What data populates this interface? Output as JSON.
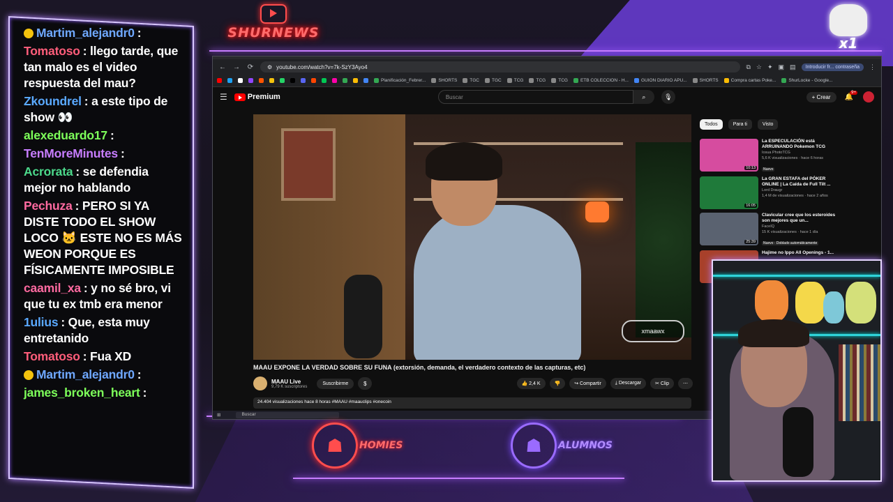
{
  "chat": {
    "messages": [
      {
        "user": "Martim_alejandr0",
        "text": ":",
        "color": "#6fa8ff",
        "badge": "#f4c20d"
      },
      {
        "user": "Tomatoso",
        "text": ": llego tarde, que tan malo es el video respuesta del mau?",
        "color": "#ff5d7a"
      },
      {
        "user": "Zkoundrel",
        "text": ": a este tipo de show 👀",
        "color": "#5aa9ff"
      },
      {
        "user": "alexeduardo17",
        "text": ":",
        "color": "#7dff5a"
      },
      {
        "user": "TenMoreMinutes",
        "text": ":",
        "color": "#c77dff"
      },
      {
        "user": "Acrorata",
        "text": ": se defendia mejor no hablando",
        "color": "#4cd98b"
      },
      {
        "user": "Pechuza",
        "text": ": PERO SI YA DISTE TODO EL SHOW LOCO 🐱 ESTE NO ES MÁS WEON PORQUE ES FÍSICAMENTE IMPOSIBLE",
        "color": "#ff6aa0"
      },
      {
        "user": "caamil_xa",
        "text": ": y no sé bro, vi que tu ex tmb era menor",
        "color": "#ff6aa0"
      },
      {
        "user": "1ulius",
        "text": ": Que, esta muy entretanido",
        "color": "#5aa9ff"
      },
      {
        "user": "Tomatoso",
        "text": ": Fua XD",
        "color": "#ff5d7a"
      },
      {
        "user": "Martim_alejandr0",
        "text": ":",
        "color": "#6fa8ff",
        "badge": "#f4c20d"
      },
      {
        "user": "james_broken_heart",
        "text": ":",
        "color": "#7dff5a"
      }
    ]
  },
  "logo": {
    "text": "SHURNEWS"
  },
  "x1": {
    "text": "x1"
  },
  "browser": {
    "url": "youtube.com/watch?v=7k-SzY3Ayo4",
    "profile_pill": "Introducir fr... contraseña",
    "bookmarks": [
      {
        "label": "",
        "color": "#ff0000"
      },
      {
        "label": "",
        "color": "#1da1f2"
      },
      {
        "label": "",
        "color": "#fff"
      },
      {
        "label": "",
        "color": "#9146ff"
      },
      {
        "label": "",
        "color": "#ff5500"
      },
      {
        "label": "",
        "color": "#f4c20d"
      },
      {
        "label": "",
        "color": "#25d366"
      },
      {
        "label": "",
        "color": "#000"
      },
      {
        "label": "",
        "color": "#5865f2"
      },
      {
        "label": "",
        "color": "#ff4500"
      },
      {
        "label": "",
        "color": "#00c853"
      },
      {
        "label": "",
        "color": "#ff00aa"
      },
      {
        "label": "",
        "color": "#34a853"
      },
      {
        "label": "",
        "color": "#fbbc04"
      },
      {
        "label": "",
        "color": "#4285f4"
      },
      {
        "label": "Planificación_Febrer...",
        "color": "#34a853"
      },
      {
        "label": "SHORTS",
        "color": "#888"
      },
      {
        "label": "TGC",
        "color": "#888"
      },
      {
        "label": "TGC",
        "color": "#888"
      },
      {
        "label": "TCG",
        "color": "#888"
      },
      {
        "label": "TCG",
        "color": "#888"
      },
      {
        "label": "TCG",
        "color": "#888"
      },
      {
        "label": "ETB COLECCION - H...",
        "color": "#34a853"
      },
      {
        "label": "GUION DIARIO APU...",
        "color": "#4285f4"
      },
      {
        "label": "SHORTS",
        "color": "#888"
      },
      {
        "label": "Compra cartas Poke...",
        "color": "#fbbc04"
      },
      {
        "label": "ShurLocke - Google...",
        "color": "#34a853"
      }
    ],
    "yt": {
      "brand": "Premium",
      "search_placeholder": "Buscar",
      "create": "+ Crear",
      "bell_count": "9+",
      "video_tag": "xmaawx",
      "video_tag_top": "twitch",
      "title": "MAAU EXPONE LA VERDAD SOBRE SU FUNA (extorsión, demanda, el verdadero contexto de las capturas, etc)",
      "channel": "MAAU Live",
      "subs": "9,79 K suscriptores",
      "subscribe": "Suscribirme",
      "dollar": "$",
      "likes": "👍 2,4 K",
      "dislike": "👎",
      "share": "↪ Compartir",
      "download": "⤓ Descargar",
      "clip": "✂ Clip",
      "more": "⋯",
      "description": "24.404 visualizaciones  hace 8 horas  #MAAU #maauclips #onecoin",
      "filters": [
        "Todos",
        "Para ti",
        "Visto"
      ],
      "recs": [
        {
          "title": "La ESPECULACIÓN está ARRUINANDO Pokemon TCG",
          "channel": "Iosua PhotoTCG",
          "meta": "5,6 K visualizaciones · hace 6 horas",
          "badge": "Nuevo",
          "duration": "10:13",
          "thumb": "#d64c9f"
        },
        {
          "title": "La GRAN ESTAFA del PÓKER ONLINE | La Caída de Full Tilt ...",
          "channel": "Lord Draugr",
          "meta": "1,4 M de visualizaciones · hace 2 años",
          "badge": "",
          "duration": "16:05",
          "thumb": "#1f7a3a"
        },
        {
          "title": "Clavicular cree que los esteroides son mejores que un...",
          "channel": "FaceIQ",
          "meta": "15 K visualizaciones · hace 1 día",
          "badge": "Nuevo · Doblado automáticamente",
          "duration": "25:39",
          "thumb": "#5a6270"
        },
        {
          "title": "Hajime no Ippo All Openings - 1...",
          "channel": "",
          "meta": "",
          "badge": "",
          "duration": "",
          "thumb": "#a8402a"
        }
      ]
    },
    "taskbar_search": "Buscar"
  },
  "badges": [
    {
      "text": "HOMIES",
      "color": "#ff4d4d"
    },
    {
      "text": "ALUMNOS",
      "color": "#9a6bff"
    }
  ]
}
